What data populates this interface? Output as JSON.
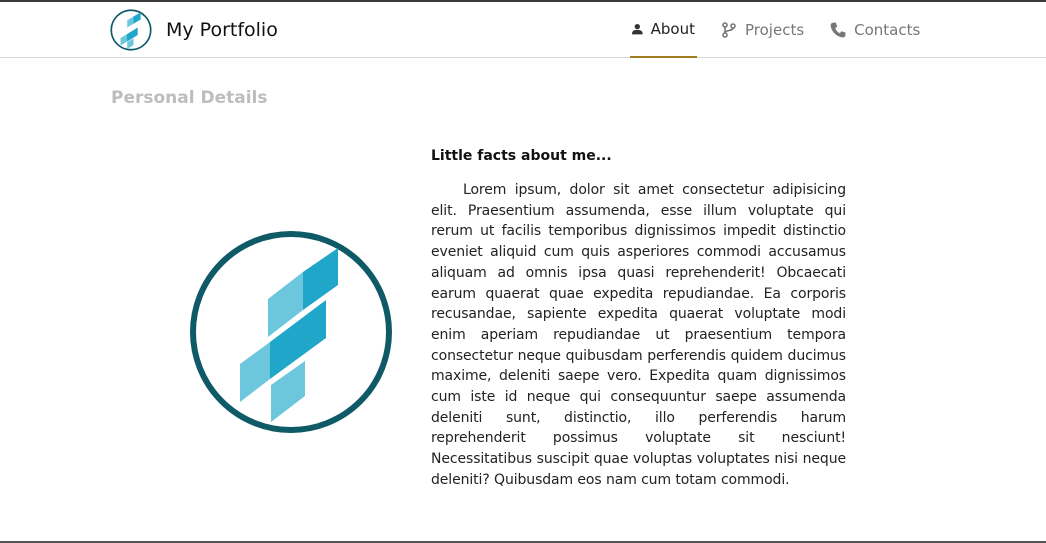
{
  "header": {
    "brand_title": "My Portfolio",
    "nav": [
      {
        "label": "About",
        "icon": "user-icon",
        "active": true
      },
      {
        "label": "Projects",
        "icon": "git-branch-icon",
        "active": false
      },
      {
        "label": "Contacts",
        "icon": "phone-icon",
        "active": false
      }
    ]
  },
  "main": {
    "section_title": "Personal Details",
    "facts_heading": "Little facts about me...",
    "facts_text": "Lorem ipsum, dolor sit amet consectetur adipisicing elit. Praesentium assumenda, esse illum voluptate qui rerum ut facilis temporibus dignissimos impedit distinctio eveniet aliquid cum quis asperiores commodi accusamus aliquam ad omnis ipsa quasi reprehenderit! Obcaecati earum quaerat quae expedita repudiandae. Ea corporis recusandae, sapiente expedita quaerat voluptate modi enim aperiam repudiandae ut praesentium tempora consectetur neque quibusdam perferendis quidem ducimus maxime, deleniti saepe vero. Expedita quam dignissimos cum iste id neque qui consequuntur saepe assumenda deleniti sunt, distinctio, illo perferendis harum reprehenderit possimus voluptate sit nesciunt! Necessitatibus suscipit quae voluptas voluptates nisi neque deleniti? Quibusdam eos nam cum totam commodi."
  },
  "colors": {
    "logo_ring": "#0e5a67",
    "logo_light": "#6cc7dd",
    "logo_dark": "#1fa6c9",
    "active_underline": "#a07e1c",
    "section_title": "#bdbdbd"
  }
}
